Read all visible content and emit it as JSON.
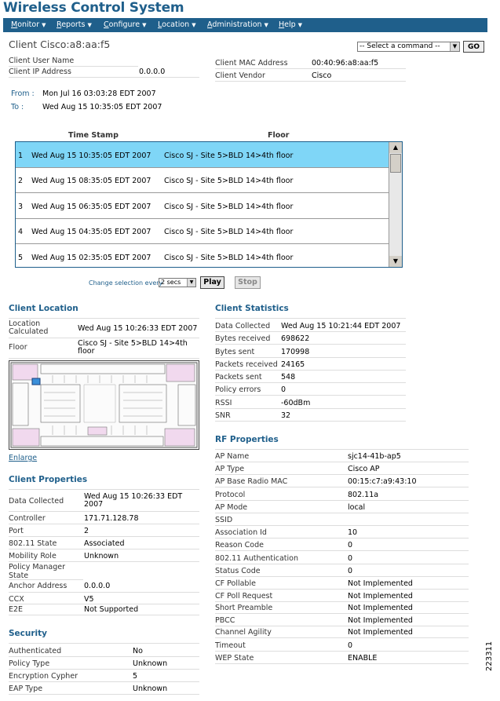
{
  "app": {
    "title": "Wireless Control System"
  },
  "menu": [
    {
      "label": "Monitor",
      "u": "M",
      "rest": "onitor"
    },
    {
      "label": "Reports",
      "u": "R",
      "rest": "eports"
    },
    {
      "label": "Configure",
      "u": "C",
      "rest": "onfigure"
    },
    {
      "label": "Location",
      "u": "L",
      "rest": "ocation"
    },
    {
      "label": "Administration",
      "u": "A",
      "rest": "dministration"
    },
    {
      "label": "Help",
      "u": "H",
      "rest": "elp"
    }
  ],
  "client": {
    "title": "Client Cisco:a8:aa:f5",
    "command_select": "-- Select a command --",
    "go_label": "GO",
    "user_name_label": "Client User Name",
    "ip_label": "Client IP Address",
    "ip_value": "0.0.0.0",
    "mac_label": "Client MAC Address",
    "mac_value": "00:40:96:a8:aa:f5",
    "vendor_label": "Client Vendor",
    "vendor_value": "Cisco",
    "from_label": "From :",
    "from_value": "Mon Jul 16 03:03:28 EDT 2007",
    "to_label": "To :",
    "to_value": "Wed Aug 15 10:35:05 EDT 2007"
  },
  "history": {
    "col_timestamp": "Time Stamp",
    "col_floor": "Floor",
    "rows": [
      {
        "n": "1",
        "ts": "Wed Aug 15 10:35:05 EDT 2007",
        "floor": "Cisco SJ - Site 5>BLD 14>4th floor"
      },
      {
        "n": "2",
        "ts": "Wed Aug 15 08:35:05 EDT 2007",
        "floor": "Cisco SJ - Site 5>BLD 14>4th floor"
      },
      {
        "n": "3",
        "ts": "Wed Aug 15 06:35:05 EDT 2007",
        "floor": "Cisco SJ - Site 5>BLD 14>4th floor"
      },
      {
        "n": "4",
        "ts": "Wed Aug 15 04:35:05 EDT 2007",
        "floor": "Cisco SJ - Site 5>BLD 14>4th floor"
      },
      {
        "n": "5",
        "ts": "Wed Aug 15 02:35:05 EDT 2007",
        "floor": "Cisco SJ - Site 5>BLD 14>4th floor"
      }
    ],
    "change_label": "Change selection every",
    "interval": "2 secs",
    "play_label": "Play",
    "stop_label": "Stop"
  },
  "client_location": {
    "heading": "Client Location",
    "calc_label_1": "Location",
    "calc_label_2": "Calculated",
    "calc_value": "Wed Aug 15 10:26:33 EDT 2007",
    "floor_label": "Floor",
    "floor_value_1": "Cisco SJ - Site 5>BLD 14>4th",
    "floor_value_2": "floor",
    "enlarge": "Enlarge"
  },
  "client_properties": {
    "heading": "Client Properties",
    "rows": [
      {
        "label": "Data Collected",
        "value": "Wed Aug 15 10:26:33 EDT",
        "value2": "2007"
      },
      {
        "label": "Controller",
        "value": "171.71.128.78"
      },
      {
        "label": "Port",
        "value": "2"
      },
      {
        "label": "802.11 State",
        "value": "Associated"
      },
      {
        "label": "Mobility Role",
        "value": "Unknown"
      },
      {
        "label": "Policy Manager",
        "label2": "State",
        "value": ""
      },
      {
        "label": "Anchor Address",
        "value": "0.0.0.0"
      },
      {
        "label": "CCX",
        "value": "V5"
      },
      {
        "label": "E2E",
        "value": "Not Supported"
      }
    ]
  },
  "security": {
    "heading": "Security",
    "rows": [
      {
        "label": "Authenticated",
        "value": "No"
      },
      {
        "label": "Policy Type",
        "value": "Unknown"
      },
      {
        "label": "Encryption Cypher",
        "value": "5"
      },
      {
        "label": "EAP Type",
        "value": "Unknown"
      }
    ]
  },
  "client_statistics": {
    "heading": "Client Statistics",
    "rows": [
      {
        "label": "Data Collected",
        "value": "Wed Aug 15 10:21:44 EDT 2007"
      },
      {
        "label": "Bytes received",
        "value": "698622"
      },
      {
        "label": "Bytes sent",
        "value": "170998"
      },
      {
        "label": "Packets received",
        "value": "24165"
      },
      {
        "label": "Packets sent",
        "value": "548"
      },
      {
        "label": "Policy errors",
        "value": "0"
      },
      {
        "label": "RSSI",
        "value": "-60dBm"
      },
      {
        "label": "SNR",
        "value": "32"
      }
    ]
  },
  "rf_properties": {
    "heading": "RF Properties",
    "rows": [
      {
        "label": "AP Name",
        "value": "sjc14-41b-ap5"
      },
      {
        "label": "AP Type",
        "value": "Cisco AP"
      },
      {
        "label": "AP Base Radio MAC",
        "value": "00:15:c7:a9:43:10"
      },
      {
        "label": "Protocol",
        "value": "802.11a"
      },
      {
        "label": "AP Mode",
        "value": "local"
      },
      {
        "label": "SSID",
        "value": ""
      },
      {
        "label": "Association Id",
        "value": "10"
      },
      {
        "label": "Reason Code",
        "value": "0"
      },
      {
        "label": "802.11 Authentication",
        "value": "0"
      },
      {
        "label": "Status Code",
        "value": "0"
      },
      {
        "label": "CF Pollable",
        "value": "Not Implemented"
      },
      {
        "label": "CF Poll Request",
        "value": "Not Implemented"
      },
      {
        "label": "Short Preamble",
        "value": "Not Implemented"
      },
      {
        "label": "PBCC",
        "value": "Not Implemented"
      },
      {
        "label": "Channel Agility",
        "value": "Not Implemented"
      },
      {
        "label": "Timeout",
        "value": "0"
      },
      {
        "label": "WEP State",
        "value": "ENABLE"
      }
    ]
  },
  "figure_id": "223311"
}
